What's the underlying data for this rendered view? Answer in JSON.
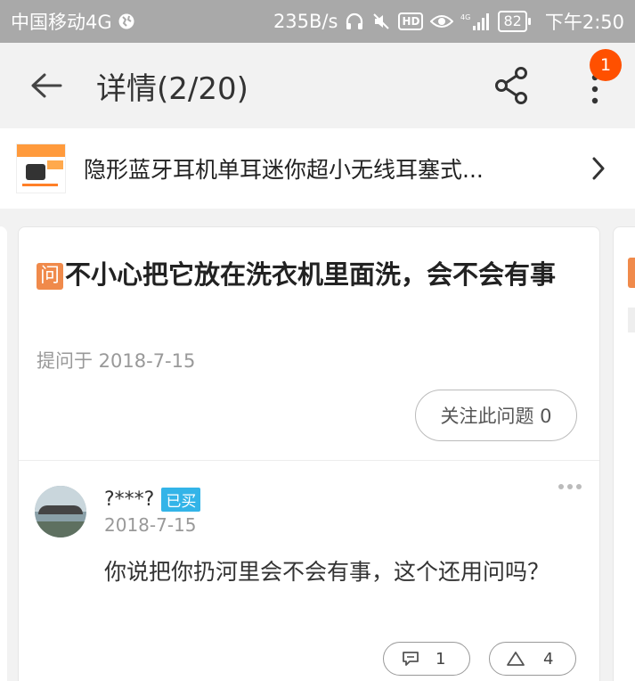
{
  "status_bar": {
    "carrier": "中国移动4G",
    "speed": "235B/s",
    "hd_label": "HD",
    "network": "4G",
    "battery": "82",
    "time": "下午2:50"
  },
  "app_bar": {
    "title": "详情(2/20)",
    "notification_count": "1"
  },
  "product": {
    "name": "隐形蓝牙耳机单耳迷你超小无线耳塞式..."
  },
  "question": {
    "icon_label": "问",
    "text": "不小心把它放在洗衣机里面洗，会不会有事",
    "asked_date": "提问于 2018-7-15",
    "follow_label": "关注此问题 0"
  },
  "answer": {
    "username": "?***?",
    "badge": "已买",
    "date": "2018-7-15",
    "text": "你说把你扔河里会不会有事，这个还用问吗？",
    "reply_count": "1",
    "like_count": "4"
  },
  "colors": {
    "accent": "#ff5000",
    "question_icon": "#f08a4b",
    "bought_badge": "#33b4e8",
    "status_bar": "#a9a9a9"
  }
}
